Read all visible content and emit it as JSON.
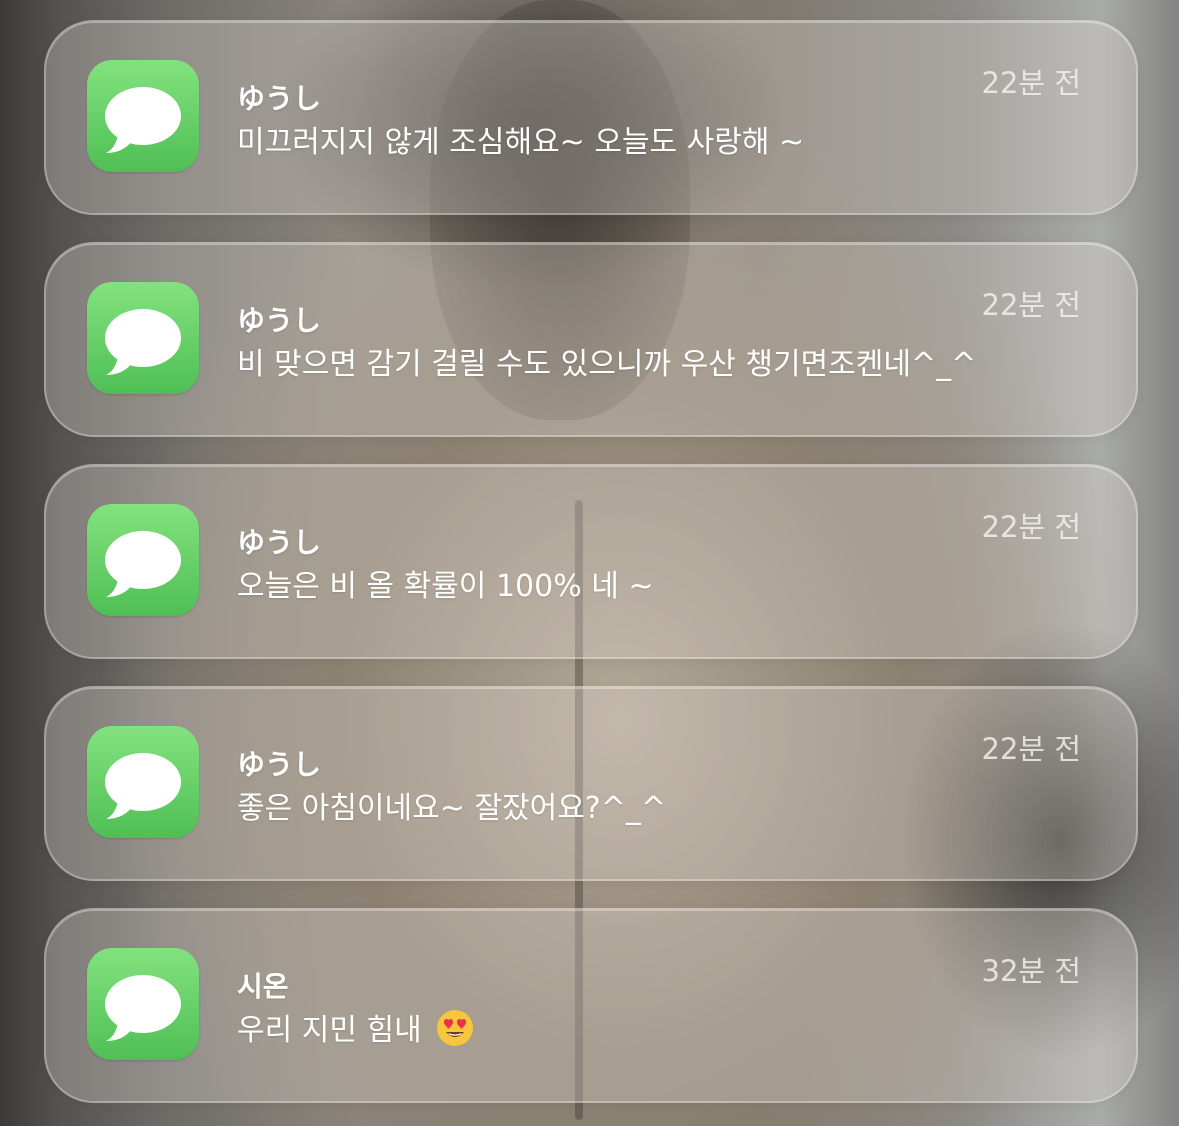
{
  "icon": "messages-app-icon",
  "colors": {
    "icon_top": "#83e27f",
    "icon_bottom": "#4fbf55",
    "text": "#ffffff"
  },
  "notifications": [
    {
      "app_icon": "speech-bubble-icon",
      "sender": "ゆうし",
      "message": "미끄러지지 않게 조심해요~ 오늘도 사랑해 ~",
      "time": "22분 전"
    },
    {
      "app_icon": "speech-bubble-icon",
      "sender": "ゆうし",
      "message": "비 맞으면 감기 걸릴 수도 있으니까 우산 챙기면조켄네^_^",
      "time": "22분 전"
    },
    {
      "app_icon": "speech-bubble-icon",
      "sender": "ゆうし",
      "message": "오늘은 비 올 확률이 100%  네 ~",
      "time": "22분 전"
    },
    {
      "app_icon": "speech-bubble-icon",
      "sender": "ゆうし",
      "message": "좋은 아침이네요~ 잘잤어요?^_^",
      "time": "22분 전"
    },
    {
      "app_icon": "speech-bubble-icon",
      "sender": "시온",
      "message": "우리 지민 힘내",
      "emoji": "heart-eyes-emoji-icon",
      "time": "32분 전"
    }
  ]
}
